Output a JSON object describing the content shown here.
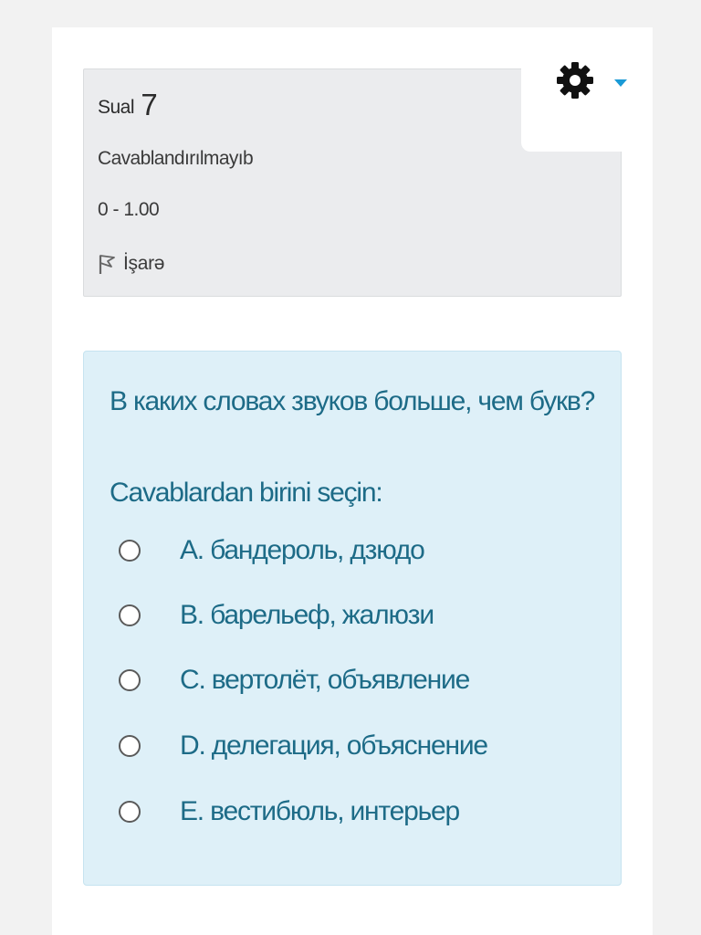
{
  "question_info": {
    "label": "Sual",
    "number": "7",
    "state": "Cavablandırılmayıb",
    "grade": "0 - 1.00",
    "flag_label": "İşarə"
  },
  "settings_menu": {
    "gear_icon": "gear-icon",
    "caret_icon": "caret-down-icon",
    "accent_color": "#1a9ad6"
  },
  "question": {
    "text": "В каких словах звуков больше, чем букв?",
    "prompt": "Cavablardan birini seçin:",
    "options": [
      {
        "label": "A. бандероль, дзюдо",
        "selected": false
      },
      {
        "label": "B. барельеф, жалюзи",
        "selected": false
      },
      {
        "label": "C. вертолёт, объявление",
        "selected": false
      },
      {
        "label": "D. делегация, объяснение",
        "selected": false
      },
      {
        "label": "E. вестибюль, интерьер",
        "selected": false
      }
    ]
  },
  "colors": {
    "info_box_bg": "#ebecee",
    "question_box_bg": "#def0f8",
    "question_text": "#1d6b87"
  }
}
